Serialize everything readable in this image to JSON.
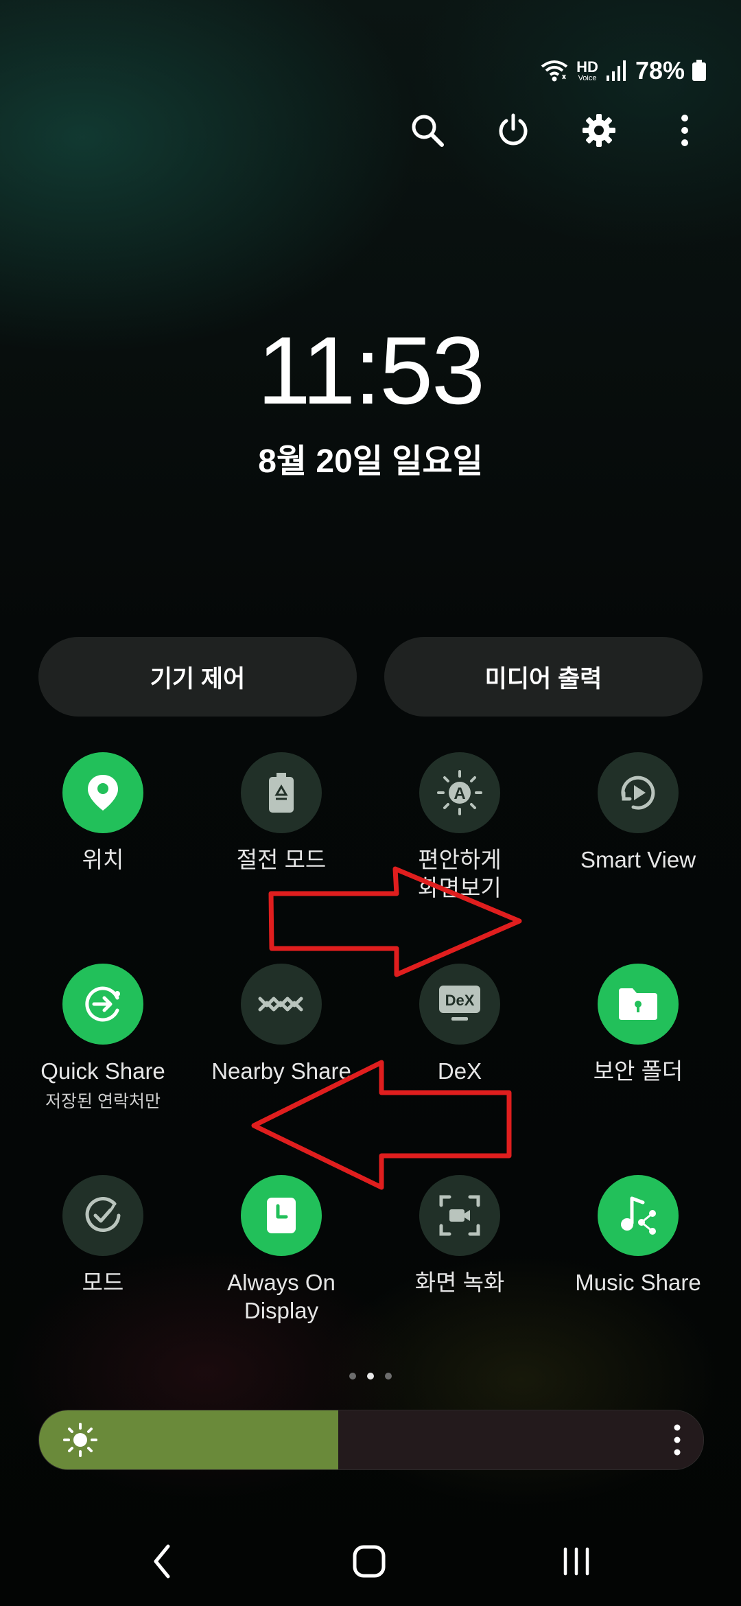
{
  "status": {
    "hd_label": "HD",
    "voice_label": "Voice",
    "battery": "78%"
  },
  "top_actions": [
    "search-icon",
    "power-icon",
    "gear-icon",
    "more-vert-icon"
  ],
  "clock": {
    "time": "11:53",
    "date": "8월 20일 일요일"
  },
  "pills": {
    "device_control": "기기 제어",
    "media_output": "미디어 출력"
  },
  "tiles": [
    {
      "label": "위치",
      "icon": "location-pin-icon",
      "active": true
    },
    {
      "label": "절전 모드",
      "icon": "battery-saver-icon",
      "active": false
    },
    {
      "label": "편안하게\n화면보기",
      "icon": "eye-comfort-icon",
      "active": false
    },
    {
      "label": "Smart View",
      "icon": "smart-view-icon",
      "active": false
    },
    {
      "label": "Quick Share",
      "sublabel": "저장된 연락처만",
      "icon": "quick-share-icon",
      "active": true
    },
    {
      "label": "Nearby Share",
      "icon": "nearby-share-icon",
      "active": false
    },
    {
      "label": "DeX",
      "icon": "dex-icon",
      "active": false,
      "icon_text": "DeX"
    },
    {
      "label": "보안 폴더",
      "icon": "secure-folder-icon",
      "active": true
    },
    {
      "label": "모드",
      "icon": "modes-icon",
      "active": false
    },
    {
      "label": "Always On\nDisplay",
      "icon": "always-on-display-icon",
      "active": true
    },
    {
      "label": "화면 녹화",
      "icon": "screen-recorder-icon",
      "active": false
    },
    {
      "label": "Music Share",
      "icon": "music-share-icon",
      "active": true
    }
  ],
  "pager": {
    "pages": 3,
    "current": 2
  },
  "brightness": {
    "level": 0.45
  },
  "colors": {
    "tile_on": "#22c05a",
    "tile_off": "#213028",
    "brightness_fill": "#6a8a3a",
    "arrow": "#e01e1e"
  }
}
